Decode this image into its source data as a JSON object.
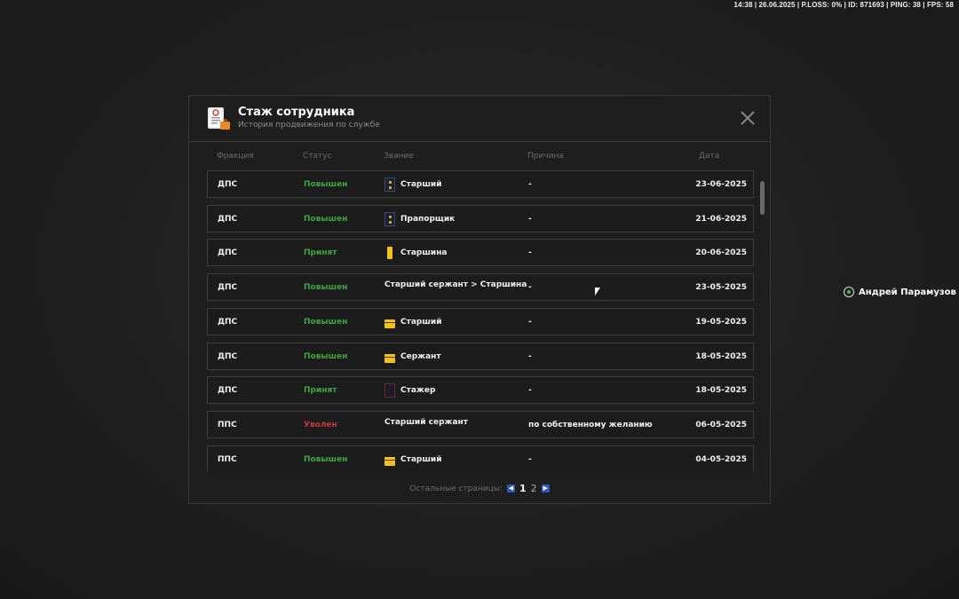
{
  "hud": {
    "text": "14:38 | 26.06.2025 | P.LOSS: 0% | ID: 871693 | PING: 38 | FPS: 58"
  },
  "modal": {
    "title": "Стаж сотрудника",
    "subtitle": "История продвижения по службе",
    "icon": "document-badge-icon"
  },
  "columns": {
    "faction": "Фракция",
    "status": "Статус",
    "rank": "Звание",
    "reason": "Причина",
    "date": "Дата"
  },
  "rows": [
    {
      "faction": "ДПС",
      "status": "Повышен",
      "status_color": "#3da63d",
      "rank": "Старший",
      "rank_icon": "dots",
      "reason": "-",
      "date": "23-06-2025"
    },
    {
      "faction": "ДПС",
      "status": "Повышен",
      "status_color": "#3da63d",
      "rank": "Прапорщик",
      "rank_icon": "dots",
      "reason": "-",
      "date": "21-06-2025"
    },
    {
      "faction": "ДПС",
      "status": "Принят",
      "status_color": "#3da63d",
      "rank": "Старшина",
      "rank_icon": "gold-vert",
      "reason": "-",
      "date": "20-06-2025"
    },
    {
      "faction": "ДПС",
      "status": "Повышен",
      "status_color": "#3da63d",
      "rank": "Старший сержант > Старшина",
      "rank_icon": "",
      "reason": "-",
      "date": "23-05-2025"
    },
    {
      "faction": "ДПС",
      "status": "Повышен",
      "status_color": "#3da63d",
      "rank": "Старший",
      "rank_icon": "gold-horz",
      "reason": "-",
      "date": "19-05-2025"
    },
    {
      "faction": "ДПС",
      "status": "Повышен",
      "status_color": "#3da63d",
      "rank": "Сержант",
      "rank_icon": "gold-horz",
      "reason": "-",
      "date": "18-05-2025"
    },
    {
      "faction": "ДПС",
      "status": "Принят",
      "status_color": "#3da63d",
      "rank": "Стажер",
      "rank_icon": "empty",
      "reason": "-",
      "date": "18-05-2025"
    },
    {
      "faction": "ППС",
      "status": "Уволен",
      "status_color": "#c83a3a",
      "rank": "Старший сержант",
      "rank_icon": "",
      "reason": "по собственному желанию",
      "date": "06-05-2025"
    },
    {
      "faction": "ППС",
      "status": "Повышен",
      "status_color": "#3da63d",
      "rank": "Старший",
      "rank_icon": "gold-horz",
      "reason": "-",
      "date": "04-05-2025"
    }
  ],
  "pager": {
    "label": "Остальные страницы:",
    "pages": [
      "1",
      "2"
    ],
    "active": "1"
  },
  "player": {
    "name": "Андрей Парамузов"
  }
}
